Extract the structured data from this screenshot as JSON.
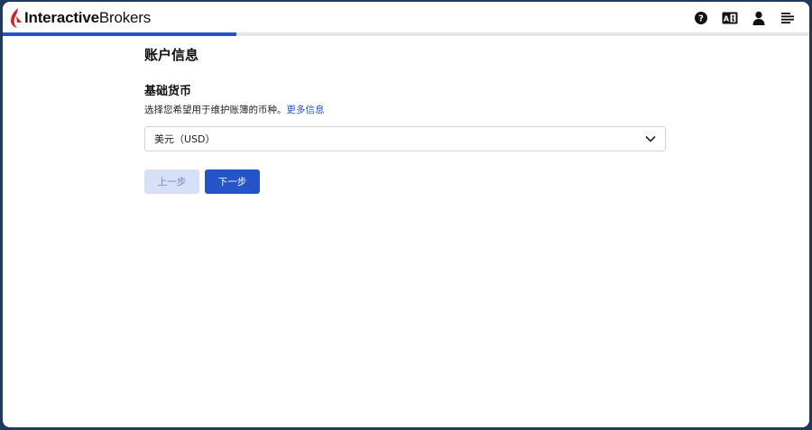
{
  "brand": {
    "logo_bold": "Interactive",
    "logo_regular": "Brokers",
    "accent_color": "#2454c8",
    "logo_mark_color": "#d81e2c"
  },
  "header": {
    "icons": [
      "help-icon",
      "language-icon",
      "user-icon",
      "menu-icon"
    ]
  },
  "progress": {
    "fraction": 0.29
  },
  "page": {
    "title": "账户信息"
  },
  "section": {
    "title": "基础货币",
    "description": "选择您希望用于维护账簿的币种。",
    "more_link": "更多信息"
  },
  "currency_select": {
    "selected": "美元（USD）"
  },
  "buttons": {
    "prev_label": "上一步",
    "next_label": "下一步"
  }
}
